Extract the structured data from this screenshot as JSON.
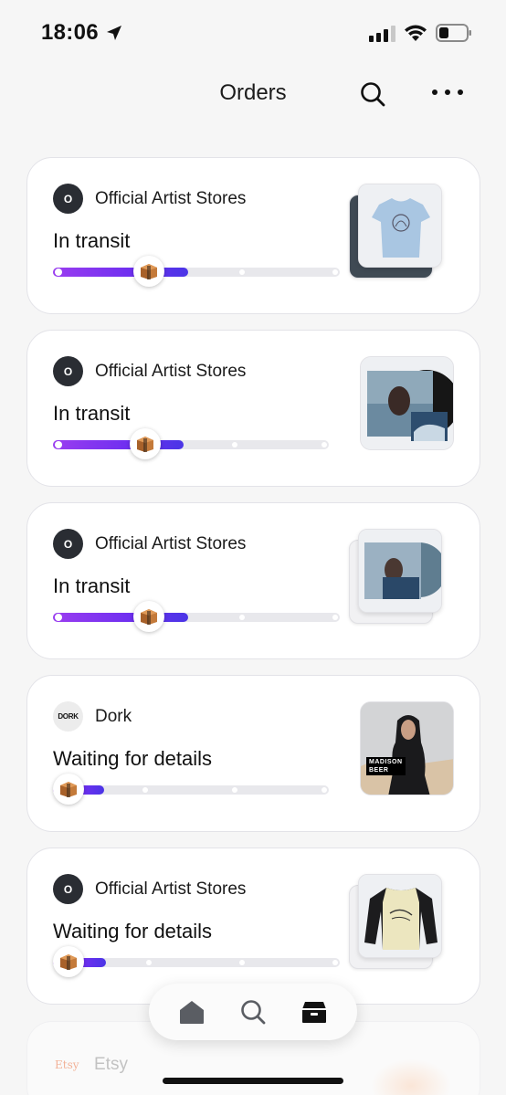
{
  "status_bar": {
    "time": "18:06"
  },
  "header": {
    "title": "Orders"
  },
  "orders": [
    {
      "store": "Official Artist Stores",
      "avatar_letter": "O",
      "status": "In transit",
      "progress": 0.33,
      "thumb": "tshirt-stack"
    },
    {
      "store": "Official Artist Stores",
      "avatar_letter": "O",
      "status": "In transit",
      "progress": 0.33,
      "thumb": "vinyl-single"
    },
    {
      "store": "Official Artist Stores",
      "avatar_letter": "O",
      "status": "In transit",
      "progress": 0.33,
      "thumb": "vinyl-stack"
    },
    {
      "store": "Dork",
      "avatar_letter": "DORK",
      "status": "Waiting for details",
      "progress": 0.05,
      "thumb": "magazine-single"
    },
    {
      "store": "Official Artist Stores",
      "avatar_letter": "O",
      "status": "Waiting for details",
      "progress": 0.05,
      "thumb": "raglan-stack"
    }
  ],
  "faded_order": {
    "store": "Etsy",
    "logo_text": "Etsy"
  },
  "magazine": {
    "line1": "MADISON",
    "line2": "BEER"
  },
  "bottom_nav": {
    "items": [
      "home-icon",
      "search-icon",
      "orders-box-icon"
    ],
    "active": "orders-box-icon"
  },
  "colors": {
    "progress_start": "#9a3df0",
    "progress_end": "#4a35e6",
    "avatar": "#2a2d33"
  }
}
